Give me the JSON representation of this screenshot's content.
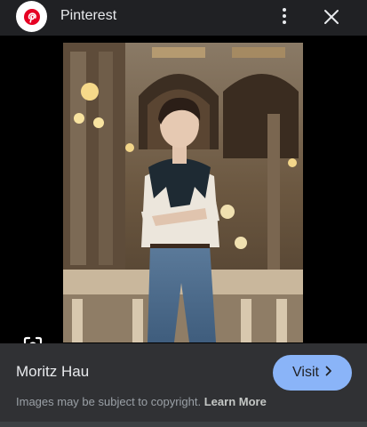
{
  "header": {
    "site_name": "Pinterest",
    "brand_color": "#e60023",
    "logo_icon": "pinterest-logo-icon",
    "more_icon": "more-vert-icon",
    "close_icon": "close-icon"
  },
  "viewer": {
    "lens_icon": "google-lens-icon"
  },
  "info": {
    "source_title": "Moritz Hau",
    "visit_label": "Visit",
    "visit_icon": "chevron-right-icon",
    "copyright_text": "Images may be subject to copyright.",
    "learn_more_label": "Learn More",
    "accent_color": "#8ab4f8"
  }
}
